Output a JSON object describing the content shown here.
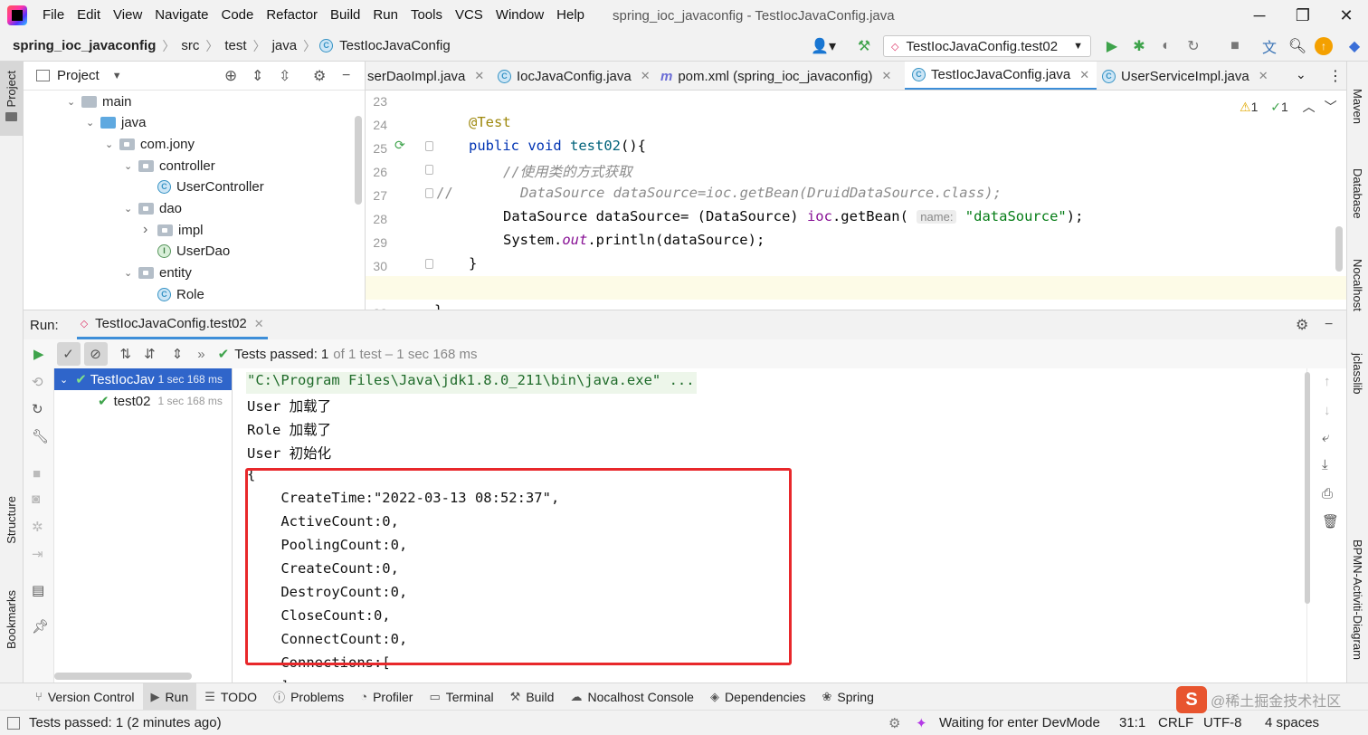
{
  "menubar": {
    "items": [
      "File",
      "Edit",
      "View",
      "Navigate",
      "Code",
      "Refactor",
      "Build",
      "Run",
      "Tools",
      "VCS",
      "Window",
      "Help"
    ],
    "window_title": "spring_ioc_javaconfig - TestIocJavaConfig.java"
  },
  "navbar": {
    "breadcrumbs": [
      "spring_ioc_javaconfig",
      "src",
      "test",
      "java",
      "TestIocJavaConfig"
    ],
    "run_config": "TestIocJavaConfig.test02"
  },
  "left_strip": {
    "project": "Project",
    "structure": "Structure",
    "bookmarks": "Bookmarks"
  },
  "right_strip": {
    "maven": "Maven",
    "database": "Database",
    "nocalhost": "Nocalhost",
    "jclasslib": "jclasslib",
    "bpmn": "BPMN-Activiti-Diagram"
  },
  "project_panel": {
    "title": "Project",
    "tree": [
      {
        "label": "main",
        "depth": 0,
        "kind": "folder",
        "expanded": true
      },
      {
        "label": "java",
        "depth": 1,
        "kind": "src-folder",
        "expanded": true
      },
      {
        "label": "com.jony",
        "depth": 2,
        "kind": "package",
        "expanded": true
      },
      {
        "label": "controller",
        "depth": 3,
        "kind": "package",
        "expanded": true
      },
      {
        "label": "UserController",
        "depth": 4,
        "kind": "class"
      },
      {
        "label": "dao",
        "depth": 3,
        "kind": "package",
        "expanded": true
      },
      {
        "label": "impl",
        "depth": 4,
        "kind": "package",
        "expanded": false
      },
      {
        "label": "UserDao",
        "depth": 4,
        "kind": "interface"
      },
      {
        "label": "entity",
        "depth": 3,
        "kind": "package",
        "expanded": true
      },
      {
        "label": "Role",
        "depth": 4,
        "kind": "class"
      }
    ]
  },
  "editor_tabs": [
    {
      "label": "serDaoImpl.java",
      "active": false
    },
    {
      "label": "IocJavaConfig.java",
      "active": false
    },
    {
      "label": "pom.xml (spring_ioc_javaconfig)",
      "active": false
    },
    {
      "label": "TestIocJavaConfig.java",
      "active": true
    },
    {
      "label": "UserServiceImpl.java",
      "active": false
    }
  ],
  "editor": {
    "warnings": "1",
    "checks": "1",
    "line_numbers": [
      "23",
      "24",
      "25",
      "26",
      "27",
      "28",
      "29",
      "30",
      "31",
      "32"
    ],
    "code": {
      "l24": "@Test",
      "l25_kw": "public void",
      "l25_name": "test02",
      "l25_rest": "(){",
      "l26": "//使用类的方式获取",
      "l27_prefix": "//",
      "l27": "DataSource dataSource=ioc.getBean(DruidDataSource.class);",
      "l28_a": "DataSource dataSource= (DataSource) ",
      "l28_ioc": "ioc",
      "l28_b": ".getBean(",
      "l28_hint": "name:",
      "l28_str": "\"dataSource\"",
      "l28_c": ");",
      "l29_a": "System.",
      "l29_out": "out",
      "l29_b": ".println(dataSource);",
      "l30": "}",
      "l32": "}"
    }
  },
  "run_panel": {
    "label": "Run:",
    "tab": "TestIocJavaConfig.test02",
    "status_prefix": "Tests passed:",
    "status_count": "1",
    "status_rest": "of 1 test – 1 sec 168 ms",
    "tests": [
      {
        "name": "TestIocJav",
        "time": "1 sec 168 ms",
        "depth": 0,
        "selected": true
      },
      {
        "name": "test02",
        "time": "1 sec 168 ms",
        "depth": 1,
        "selected": false
      }
    ],
    "console": [
      "\"C:\\Program Files\\Java\\jdk1.8.0_211\\bin\\java.exe\" ...",
      "User 加载了",
      "Role 加载了",
      "User 初始化",
      "{",
      "    CreateTime:\"2022-03-13 08:52:37\",",
      "    ActiveCount:0,",
      "    PoolingCount:0,",
      "    CreateCount:0,",
      "    DestroyCount:0,",
      "    CloseCount:0,",
      "    ConnectCount:0,",
      "    Connections:[",
      "    ]"
    ]
  },
  "bottom_tabs": [
    {
      "label": "Version Control",
      "icon": "branch-icon"
    },
    {
      "label": "Run",
      "icon": "run-icon",
      "active": true
    },
    {
      "label": "TODO",
      "icon": "list-icon"
    },
    {
      "label": "Problems",
      "icon": "info-icon"
    },
    {
      "label": "Profiler",
      "icon": "profiler-icon"
    },
    {
      "label": "Terminal",
      "icon": "terminal-icon"
    },
    {
      "label": "Build",
      "icon": "hammer-icon"
    },
    {
      "label": "Nocalhost Console",
      "icon": "nocalhost-icon"
    },
    {
      "label": "Dependencies",
      "icon": "layers-icon"
    },
    {
      "label": "Spring",
      "icon": "spring-icon"
    }
  ],
  "statusbar": {
    "left": "Tests passed: 1 (2 minutes ago)",
    "devmode": "Waiting for enter DevMode",
    "position": "31:1",
    "line_sep": "CRLF",
    "encoding": "UTF-8",
    "indent": "4 spaces",
    "watermark": "@稀土掘金技术社区"
  },
  "colors": {
    "accent": "#3592c4",
    "highlight_box": "#e8282b",
    "pass_green": "#3ea34b"
  }
}
